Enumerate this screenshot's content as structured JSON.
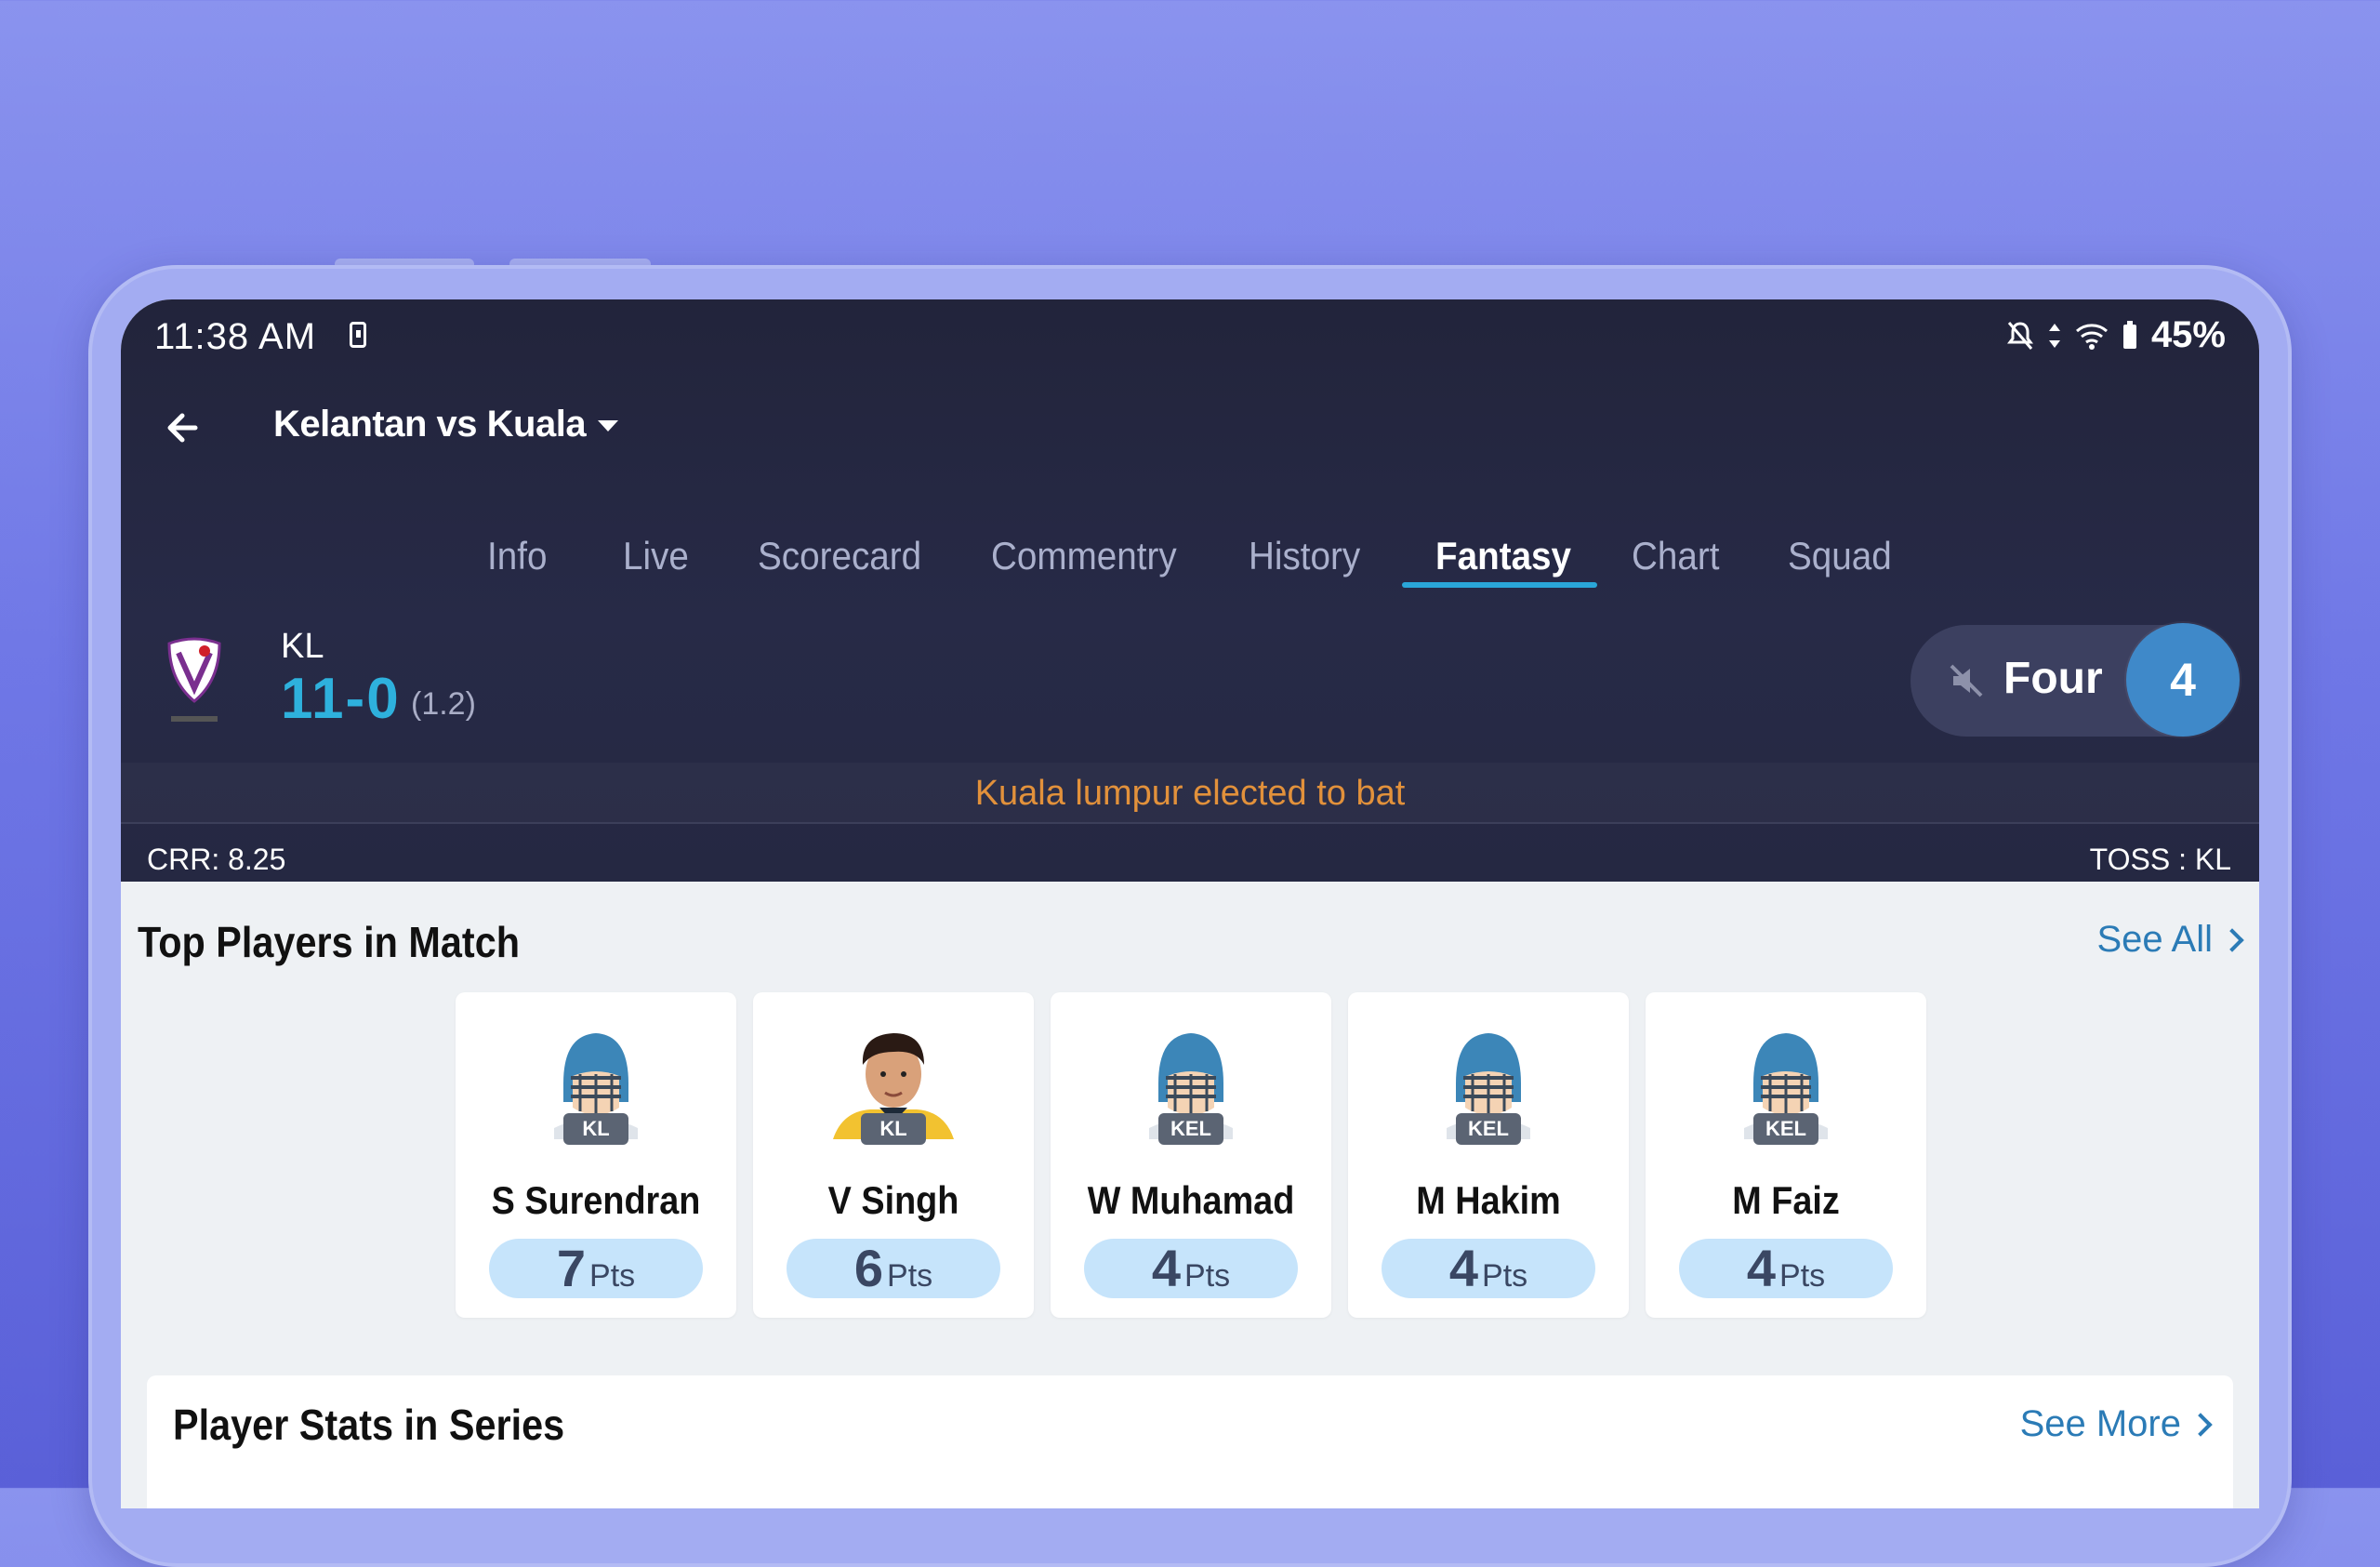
{
  "status_bar": {
    "time": "11:38 AM",
    "battery": "45%"
  },
  "header": {
    "match_title": "Kelantan vs Kuala"
  },
  "tabs": [
    {
      "label": "Info"
    },
    {
      "label": "Live"
    },
    {
      "label": "Scorecard"
    },
    {
      "label": "Commentry"
    },
    {
      "label": "History"
    },
    {
      "label": "Fantasy"
    },
    {
      "label": "Chart"
    },
    {
      "label": "Squad"
    }
  ],
  "active_tab": "Fantasy",
  "score": {
    "team": "KL",
    "runs_wickets": "11-0",
    "overs": "(1.2)"
  },
  "last_event": {
    "label": "Four",
    "runs": "4"
  },
  "toss_message": "Kuala lumpur elected to  bat",
  "crr": "CRR: 8.25",
  "toss": "TOSS : KL",
  "top_players": {
    "title": "Top Players in Match",
    "see_all": "See All",
    "players": [
      {
        "name": "S Surendran",
        "team": "KL",
        "points": "7",
        "pts_label": "Pts",
        "avatar": "helmet-icon"
      },
      {
        "name": "V Singh",
        "team": "KL",
        "points": "6",
        "pts_label": "Pts",
        "avatar": "player-photo"
      },
      {
        "name": "W Muhamad",
        "team": "KEL",
        "points": "4",
        "pts_label": "Pts",
        "avatar": "helmet-icon"
      },
      {
        "name": "M Hakim",
        "team": "KEL",
        "points": "4",
        "pts_label": "Pts",
        "avatar": "helmet-icon"
      },
      {
        "name": "M Faiz",
        "team": "KEL",
        "points": "4",
        "pts_label": "Pts",
        "avatar": "helmet-icon"
      }
    ]
  },
  "player_stats": {
    "title": "Player Stats in Series",
    "see_more": "See More"
  },
  "colors": {
    "accent": "#2aa6d8",
    "score": "#2eb1dd",
    "toss_text": "#e2913b",
    "link": "#2b7bb6",
    "pts_bg": "#c6e4fb"
  }
}
